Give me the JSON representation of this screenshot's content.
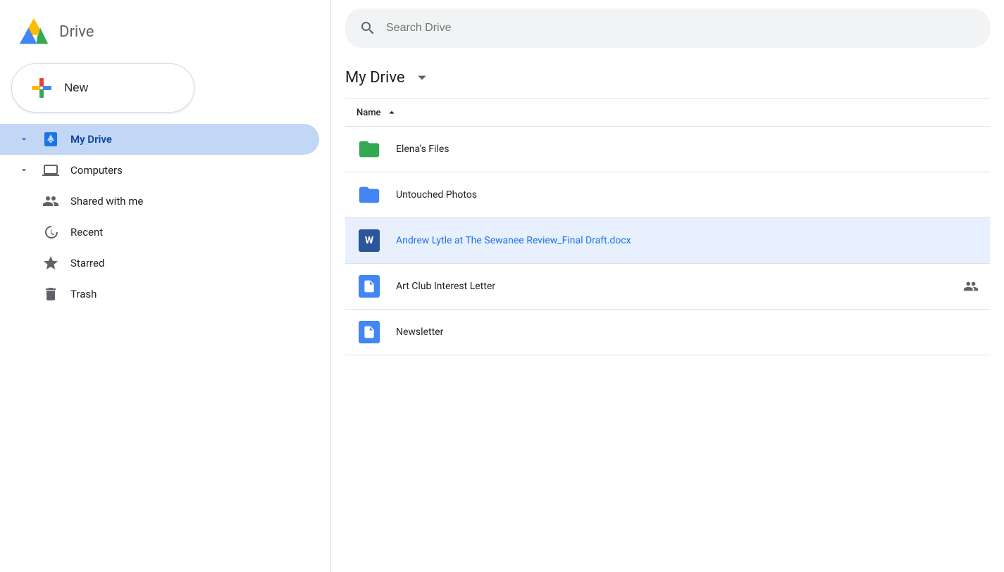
{
  "logo": {
    "text": "Drive"
  },
  "sidebar": {
    "new_button_label": "New",
    "items": [
      {
        "id": "my-drive",
        "label": "My Drive",
        "active": true,
        "icon": "drive-icon",
        "expandable": true
      },
      {
        "id": "computers",
        "label": "Computers",
        "active": false,
        "icon": "computer-icon",
        "expandable": true
      },
      {
        "id": "shared-with-me",
        "label": "Shared with me",
        "active": false,
        "icon": "people-icon",
        "expandable": false
      },
      {
        "id": "recent",
        "label": "Recent",
        "active": false,
        "icon": "clock-icon",
        "expandable": false
      },
      {
        "id": "starred",
        "label": "Starred",
        "active": false,
        "icon": "star-icon",
        "expandable": false
      },
      {
        "id": "trash",
        "label": "Trash",
        "active": false,
        "icon": "trash-icon",
        "expandable": false
      }
    ]
  },
  "search": {
    "placeholder": "Search Drive"
  },
  "main": {
    "title": "My Drive",
    "column_name": "Name",
    "files": [
      {
        "id": "elenas-files",
        "name": "Elena's Files",
        "type": "folder-green",
        "shared": false,
        "selected": false
      },
      {
        "id": "untouched-photos",
        "name": "Untouched Photos",
        "type": "folder-blue",
        "shared": false,
        "selected": false
      },
      {
        "id": "andrew-lytle",
        "name": "Andrew Lytle at The Sewanee Review_Final Draft.docx",
        "type": "word",
        "shared": false,
        "selected": true
      },
      {
        "id": "art-club",
        "name": "Art Club Interest Letter",
        "type": "gdoc",
        "shared": true,
        "selected": false
      },
      {
        "id": "newsletter",
        "name": "Newsletter",
        "type": "gdoc",
        "shared": false,
        "selected": false
      }
    ]
  }
}
